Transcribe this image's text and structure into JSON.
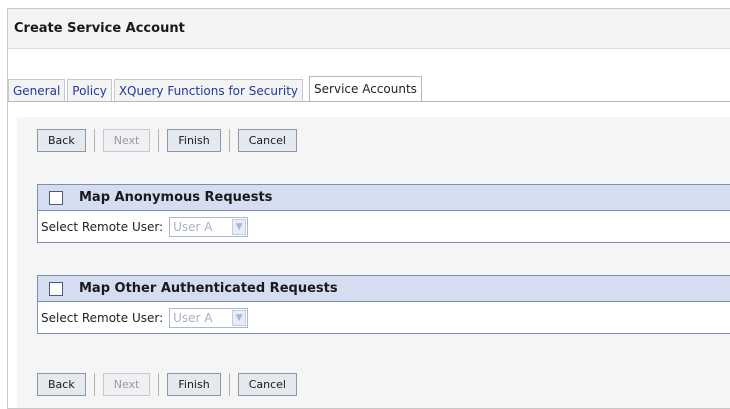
{
  "page": {
    "title": "Create Service Account"
  },
  "tabs": [
    {
      "label": "General"
    },
    {
      "label": "Policy"
    },
    {
      "label": "XQuery Functions for Security"
    },
    {
      "label": "Service Accounts",
      "active": true
    }
  ],
  "buttons": {
    "back": "Back",
    "next": "Next",
    "finish": "Finish",
    "cancel": "Cancel"
  },
  "sections": [
    {
      "title": "Map Anonymous Requests",
      "checked": false,
      "field_label": "Select Remote User:",
      "select_value": "User A"
    },
    {
      "title": "Map Other Authenticated Requests",
      "checked": false,
      "field_label": "Select Remote User:",
      "select_value": "User A"
    }
  ],
  "colors": {
    "tab_link": "#1f3a9e",
    "panel_header": "#d4def0",
    "content_bg": "#f5f5f5"
  },
  "icons": {
    "dropdown": "chevron-down-icon"
  }
}
